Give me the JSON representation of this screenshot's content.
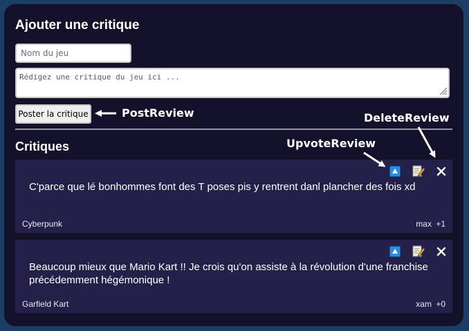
{
  "form": {
    "title": "Ajouter une critique",
    "name_placeholder": "Nom du jeu",
    "review_placeholder": "Rédigez une critique du jeu ici ...",
    "post_label": "Poster la critique"
  },
  "list": {
    "title": "Critiques",
    "reviews": [
      {
        "text": "C'parce que lé bonhommes font des T poses pis y rentrent danl plancher des fois xd",
        "game": "Cyberpunk",
        "author": "max",
        "score": "+1"
      },
      {
        "text": "Beaucoup mieux que Mario Kart !! Je crois qu'on assiste à la révolution d'une franchise précédemment hégémonique !",
        "game": "Garfield Kart",
        "author": "xam",
        "score": "+0"
      }
    ]
  },
  "annotations": {
    "post": "PostReview",
    "upvote": "UpvoteReview",
    "delete": "DeleteReview"
  },
  "icons": {
    "upvote": "upvote-icon",
    "edit": "edit-icon",
    "delete": "close-icon"
  },
  "colors": {
    "page_background": "#1c3d64",
    "panel_background": "#14112b",
    "card_background": "#23214a",
    "upvote_blue": "#2b8de0"
  }
}
